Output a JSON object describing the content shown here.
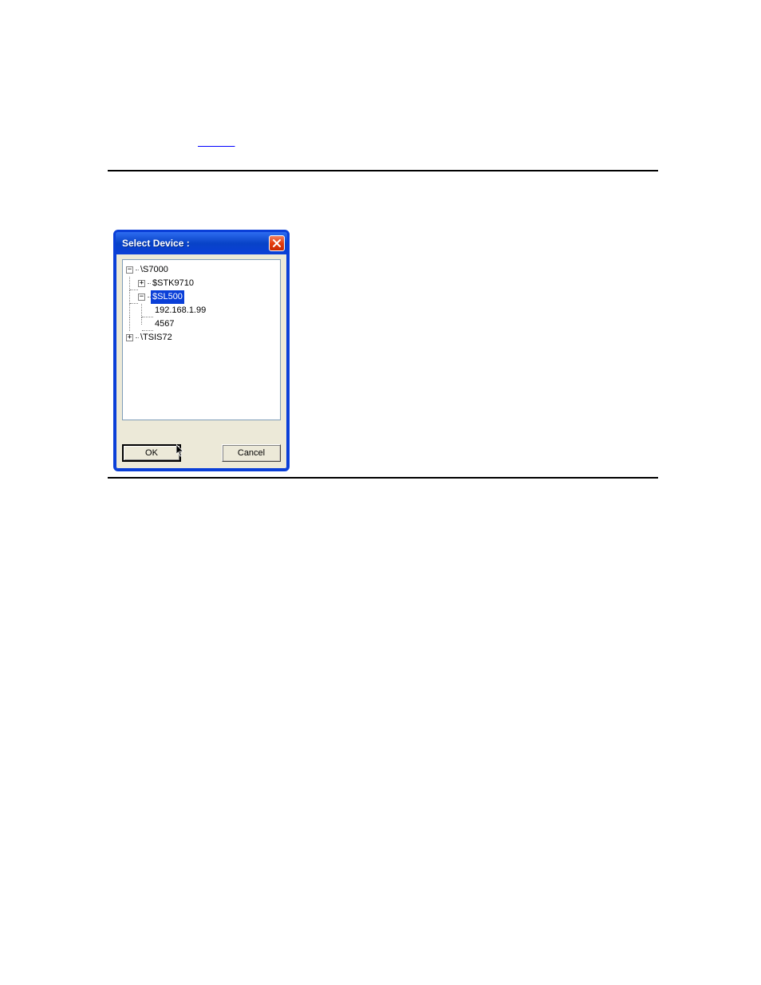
{
  "dialog": {
    "title": "Select Device :",
    "close_icon": "close-icon"
  },
  "tree": {
    "node0": {
      "label": "\\S7000",
      "expanded": true
    },
    "node0_0": {
      "label": "$STK9710",
      "expanded": false
    },
    "node0_1": {
      "label": "$SL500",
      "expanded": true,
      "selected": true
    },
    "node0_1_0": {
      "label": "192.168.1.99"
    },
    "node0_1_1": {
      "label": "4567"
    },
    "node1": {
      "label": "\\TSIS72",
      "expanded": false
    }
  },
  "buttons": {
    "ok": "OK",
    "cancel": "Cancel"
  }
}
